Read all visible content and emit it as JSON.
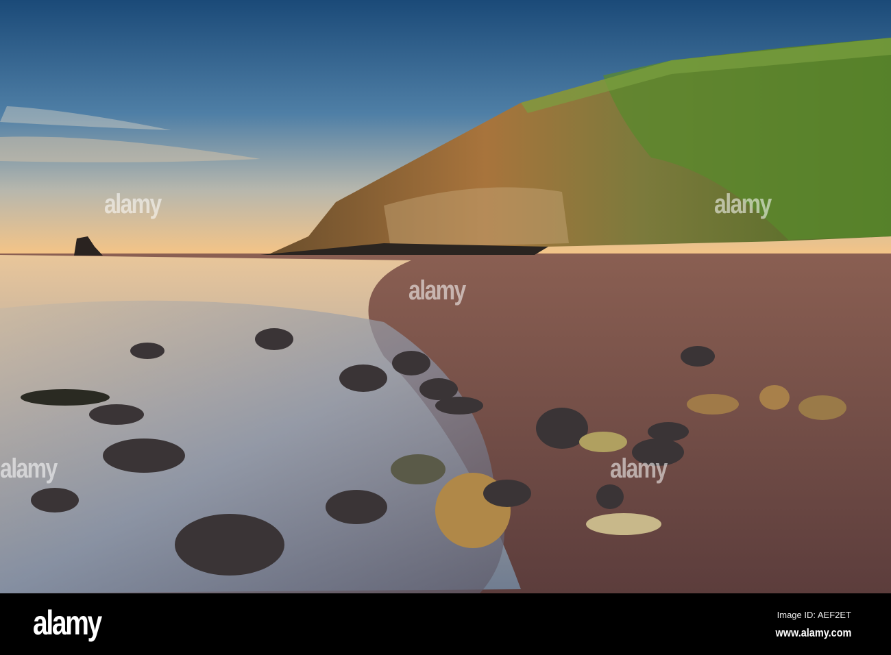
{
  "watermark": {
    "text": "alamy"
  },
  "footer": {
    "logo": "alamy",
    "image_id": "Image ID: AEF2ET",
    "website": "www.alamy.com"
  }
}
